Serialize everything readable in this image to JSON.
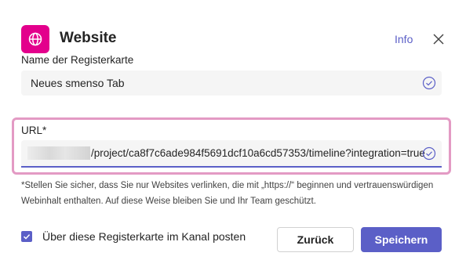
{
  "app": {
    "title": "Website",
    "icon": "globe-icon",
    "icon_color": "#e3008c"
  },
  "header": {
    "info_label": "Info",
    "close_icon": "close-icon"
  },
  "tab_name": {
    "label": "Name der Registerkarte",
    "value": "Neues smenso Tab",
    "status_icon": "check-circle-icon"
  },
  "url": {
    "label": "URL*",
    "value": "/project/ca8f7c6ade984f5691dcf10a6cd57353/timeline?integration=true",
    "status_icon": "check-circle-icon"
  },
  "disclaimer": "*Stellen Sie sicher, dass Sie nur Websites verlinken, die mit „https://“ beginnen und vertrauenswürdigen Webinhalt enthalten. Auf diese Weise bleiben Sie und Ihr Team geschützt.",
  "footer": {
    "post_label": "Über diese Registerkarte im Kanal posten",
    "post_checked": true,
    "back_label": "Zurück",
    "save_label": "Speichern"
  },
  "colors": {
    "accent": "#5b5fc7",
    "highlight": "#e39ac4",
    "field_bg": "#f5f5f5"
  }
}
